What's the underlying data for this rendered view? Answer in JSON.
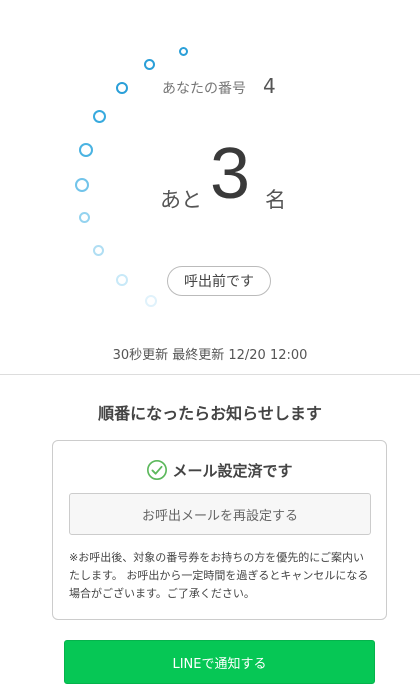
{
  "queue": {
    "number_label": "あなたの番号",
    "number_value": "4",
    "remaining_prefix": "あと",
    "remaining_count": "3",
    "remaining_suffix": "名",
    "status": "呼出前です"
  },
  "update_info": "30秒更新 最終更新 12/20 12:00",
  "notify": {
    "title": "順番になったらお知らせします",
    "mail_status": "メール設定済です",
    "reset_button": "お呼出メールを再設定する",
    "note": "※お呼出後、対象の番号券をお持ちの方を優先的にご案内いたします。 お呼出から一定時間を過ぎるとキャンセルになる場合がございます。ご了承ください。",
    "line_button": "LINEで通知する"
  },
  "colors": {
    "ring_primary": "#2a9fd8",
    "ring_faded": "#c8e9f8",
    "check": "#5cb85c",
    "line_green": "#06c755"
  },
  "icons": {
    "check": "check-circle-icon"
  }
}
